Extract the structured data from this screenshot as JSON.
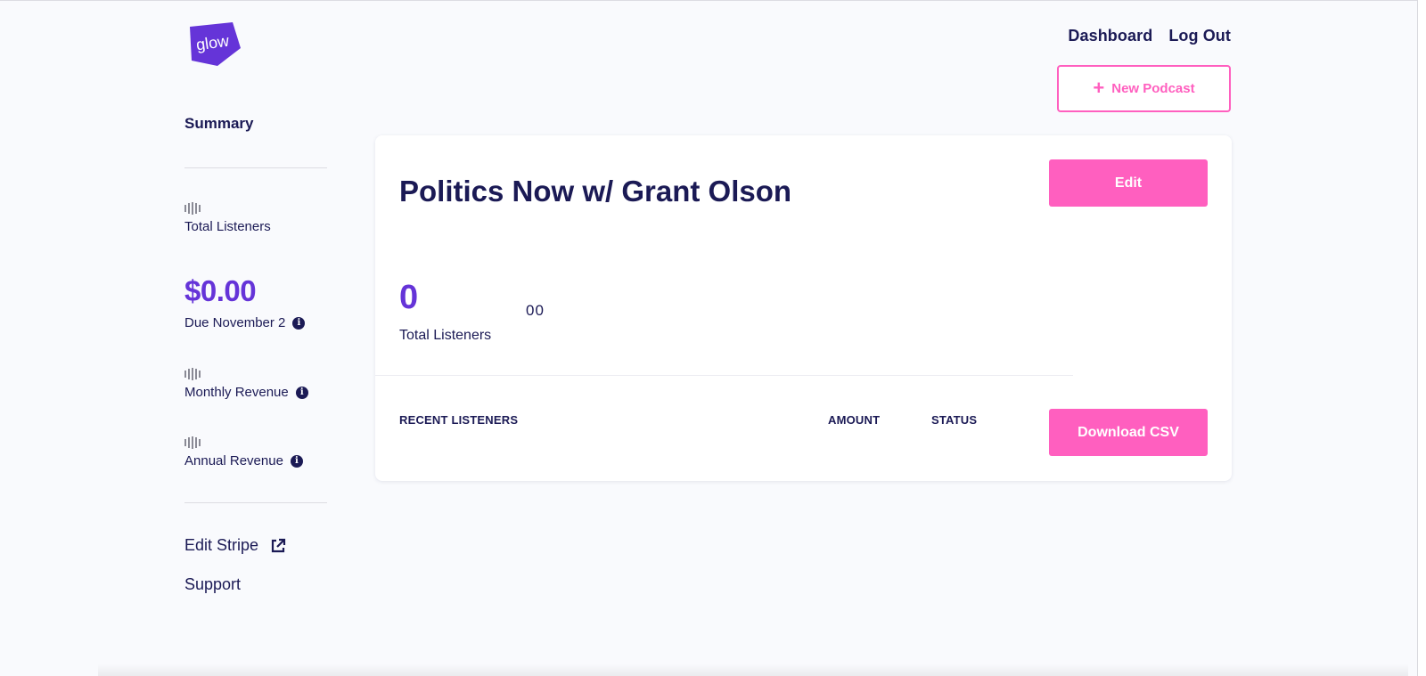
{
  "brand": {
    "logo_text": "glow",
    "logo_color": "#6534d8"
  },
  "nav": {
    "dashboard": "Dashboard",
    "logout": "Log Out"
  },
  "actions": {
    "new_podcast": "New Podcast",
    "new_podcast_icon": "plus-icon"
  },
  "sidebar": {
    "summary": "Summary",
    "total_listeners": {
      "icon": "bars-icon",
      "label": "Total Listeners"
    },
    "due": {
      "amount": "$0.00",
      "label": "Due November 2",
      "icon": "info-icon"
    },
    "monthly_revenue": {
      "icon": "bars-icon",
      "label": "Monthly Revenue",
      "info_icon": "info-icon"
    },
    "annual_revenue": {
      "icon": "bars-icon",
      "label": "Annual Revenue",
      "info_icon": "info-icon"
    },
    "edit_stripe": {
      "label": "Edit Stripe",
      "icon": "external-link-icon"
    },
    "support": "Support"
  },
  "podcast": {
    "title": "Politics Now w/ Grant Olson",
    "edit_label": "Edit",
    "stats": {
      "total_listeners_value": "0",
      "total_listeners_label": "Total Listeners",
      "secondary_value": "00"
    },
    "table_headers": {
      "recent_listeners": "RECENT LISTENERS",
      "amount": "AMOUNT",
      "status": "STATUS"
    },
    "download_label": "Download CSV"
  },
  "colors": {
    "accent_pink": "#ff5fbf",
    "accent_purple": "#6534d8",
    "text_navy": "#1b1a55",
    "background": "#f9fafd"
  }
}
